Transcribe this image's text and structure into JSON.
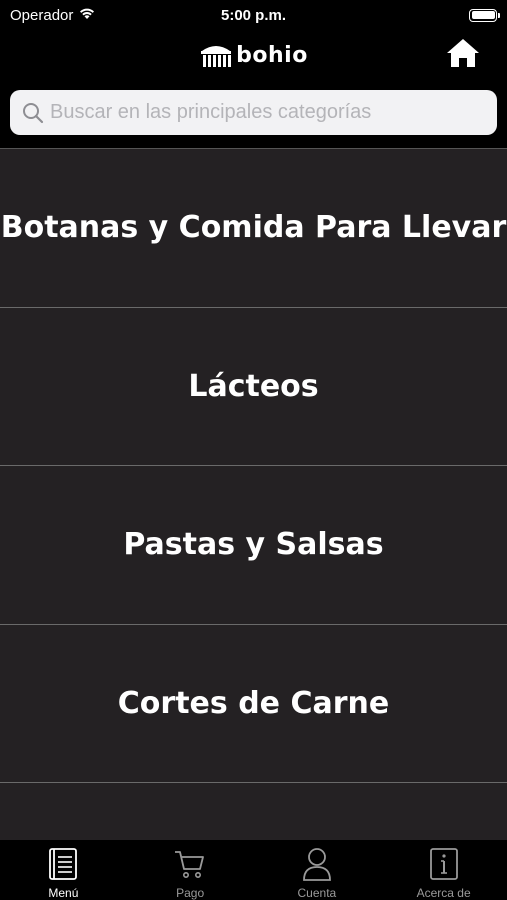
{
  "status_bar": {
    "carrier": "Operador",
    "time": "5:00 p.m.",
    "battery_level": 1.0
  },
  "header": {
    "logo_text": "bohio",
    "home_icon": "home-icon"
  },
  "search": {
    "placeholder": "Buscar en las principales categorías",
    "value": "",
    "icon": "search-icon"
  },
  "categories": [
    {
      "label": "Botanas y Comida Para Llevar"
    },
    {
      "label": "Lácteos"
    },
    {
      "label": "Pastas y Salsas"
    },
    {
      "label": "Cortes de Carne"
    },
    {
      "label": ""
    }
  ],
  "tab_bar": {
    "tabs": [
      {
        "label": "Menú",
        "icon": "menu-book-icon",
        "active": true
      },
      {
        "label": "Pago",
        "icon": "cart-icon",
        "active": false
      },
      {
        "label": "Cuenta",
        "icon": "user-icon",
        "active": false
      },
      {
        "label": "Acerca de",
        "icon": "info-icon",
        "active": false
      }
    ]
  },
  "colors": {
    "background": "#000000",
    "list_background": "#242123",
    "divider": "#6a6a6a",
    "tab_inactive": "#9a9a9a",
    "search_background": "#f2f2f4"
  }
}
